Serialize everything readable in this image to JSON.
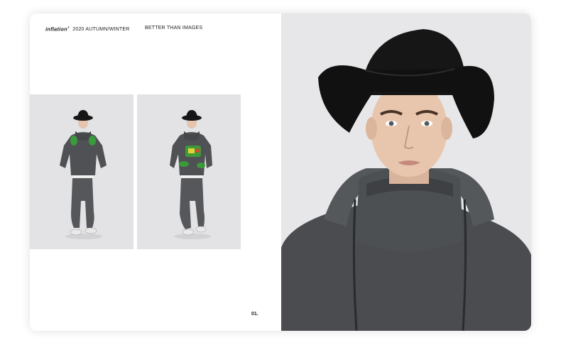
{
  "header": {
    "brand": "inflation",
    "brand_mark": "®",
    "season": "2020 AUTUMN/WINTER",
    "tagline": "BETTER THAN IMAGES"
  },
  "page_number": "01.",
  "photos": [
    {
      "name": "model-full-body-gloves-raised"
    },
    {
      "name": "model-full-body-holding-green-bag"
    },
    {
      "name": "model-portrait-bucket-hat-hoodie"
    }
  ]
}
